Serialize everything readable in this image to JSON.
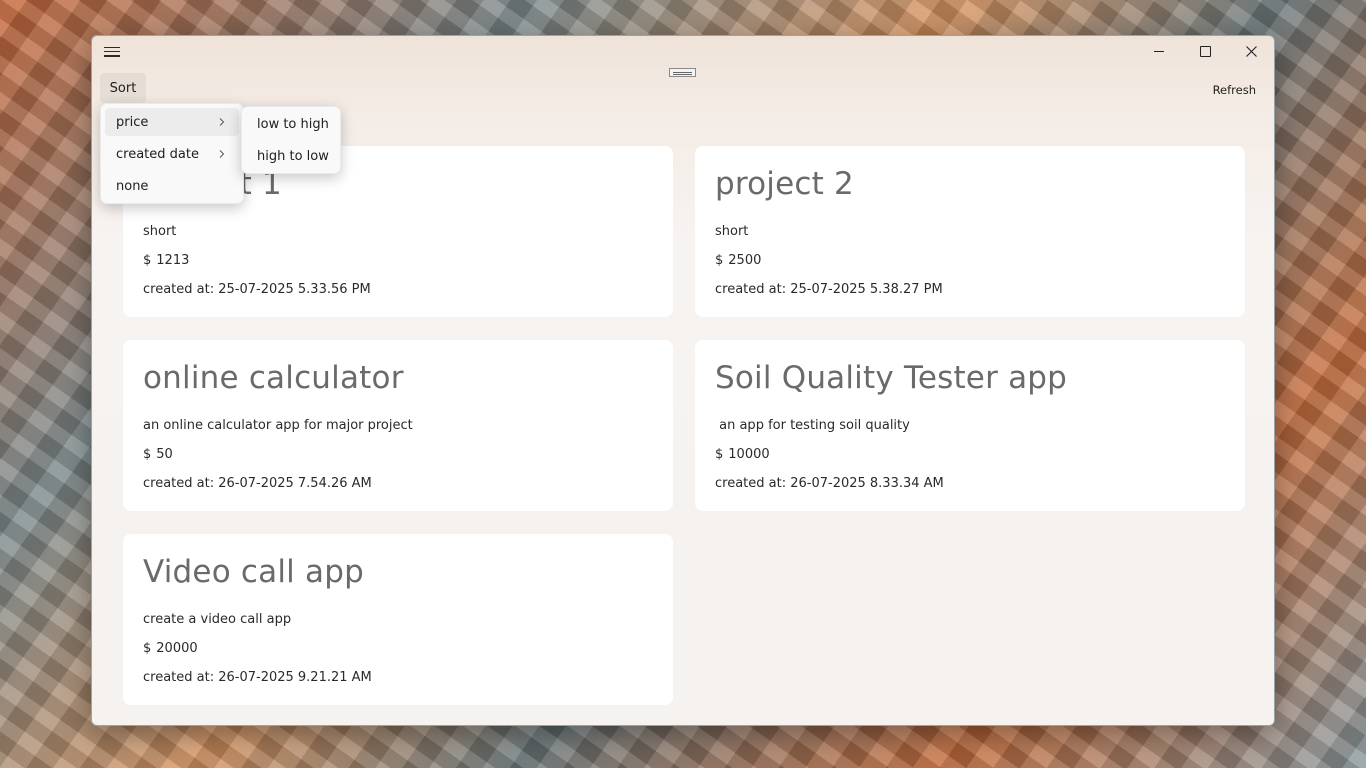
{
  "toolbar": {
    "sort_label": "Sort",
    "refresh_label": "Refresh"
  },
  "sort_menu": {
    "items": [
      {
        "label": "price",
        "has_submenu": true
      },
      {
        "label": "created date",
        "has_submenu": true
      },
      {
        "label": "none",
        "has_submenu": false
      }
    ],
    "price_submenu": [
      "low to high",
      "high to low"
    ]
  },
  "currency_symbol": "$",
  "projects": [
    {
      "title": "project 1",
      "description": "short",
      "price": "1213",
      "created": "created at: 25-07-2025 5.33.56 PM"
    },
    {
      "title": "project 2",
      "description": "short",
      "price": "2500",
      "created": "created at: 25-07-2025 5.38.27 PM"
    },
    {
      "title": "online calculator",
      "description": "an online calculator app for major project",
      "price": "50",
      "created": "created at: 26-07-2025 7.54.26 AM"
    },
    {
      "title": "Soil Quality Tester app",
      "description": " an app for testing soil quality",
      "price": "10000",
      "created": "created at: 26-07-2025 8.33.34 AM"
    },
    {
      "title": "Video call app",
      "description": "create a video call app",
      "price": "20000",
      "created": "created at: 26-07-2025 9.21.21 AM"
    }
  ]
}
